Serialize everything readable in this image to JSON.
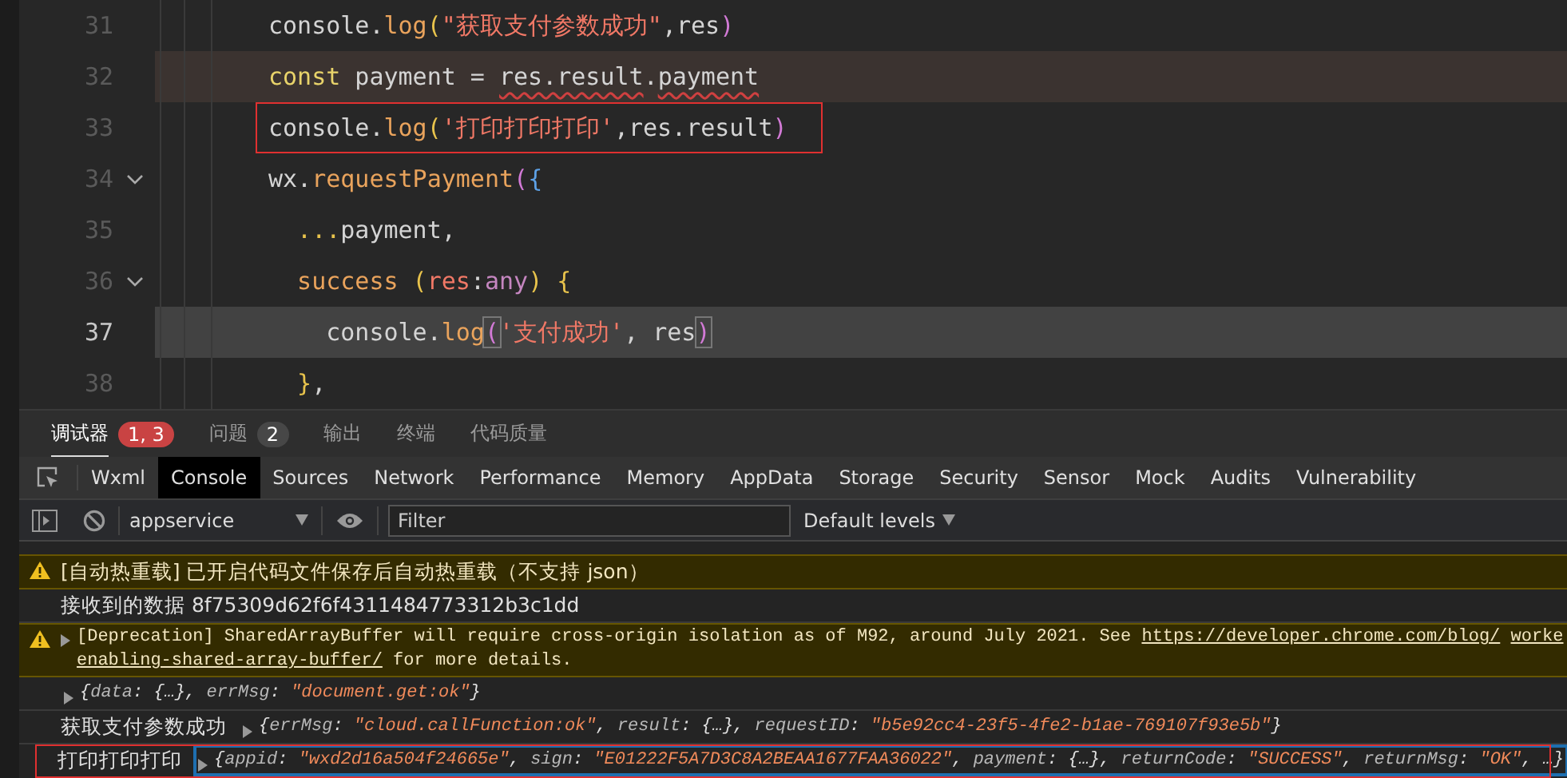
{
  "editor": {
    "lines": [
      {
        "number": "31",
        "fold": false,
        "current": false,
        "highlighted": false,
        "boxed": false,
        "tokens": [
          {
            "text": "console.",
            "kind": "plain"
          },
          {
            "text": "log",
            "kind": "method"
          },
          {
            "text": "(",
            "kind": "bracket"
          },
          {
            "text": "\"获取支付参数成功\"",
            "kind": "string"
          },
          {
            "text": ",res",
            "kind": "plain"
          },
          {
            "text": ")",
            "kind": "bracket2"
          }
        ]
      },
      {
        "number": "32",
        "fold": false,
        "current": false,
        "highlighted": true,
        "boxed": false,
        "tokens": [
          {
            "text": "const",
            "kind": "keyword"
          },
          {
            "text": " payment = ",
            "kind": "plain"
          },
          {
            "text": "res.result",
            "kind": "plain",
            "squiggle": true
          },
          {
            "text": ".",
            "kind": "plain"
          },
          {
            "text": "payment",
            "kind": "plain",
            "squiggle": true
          }
        ]
      },
      {
        "number": "33",
        "fold": false,
        "current": false,
        "highlighted": false,
        "boxed": true,
        "tokens": [
          {
            "text": "console.",
            "kind": "plain"
          },
          {
            "text": "log",
            "kind": "method"
          },
          {
            "text": "(",
            "kind": "bracket"
          },
          {
            "text": "'打印打印打印'",
            "kind": "string"
          },
          {
            "text": ",res.result",
            "kind": "plain"
          },
          {
            "text": ")",
            "kind": "bracket2"
          }
        ]
      },
      {
        "number": "34",
        "fold": true,
        "current": false,
        "highlighted": false,
        "boxed": false,
        "tokens": [
          {
            "text": "wx.",
            "kind": "plain"
          },
          {
            "text": "requestPayment",
            "kind": "method"
          },
          {
            "text": "(",
            "kind": "bracket2"
          },
          {
            "text": "{",
            "kind": "bracket3"
          }
        ]
      },
      {
        "number": "35",
        "fold": false,
        "current": false,
        "highlighted": false,
        "boxed": false,
        "tokens": [
          {
            "text": "  ...",
            "kind": "operator"
          },
          {
            "text": "payment,",
            "kind": "plain"
          }
        ]
      },
      {
        "number": "36",
        "fold": true,
        "current": false,
        "highlighted": false,
        "boxed": false,
        "tokens": [
          {
            "text": "  success",
            "kind": "method"
          },
          {
            "text": " (",
            "kind": "bracket"
          },
          {
            "text": "res",
            "kind": "param"
          },
          {
            "text": ":",
            "kind": "plain"
          },
          {
            "text": "any",
            "kind": "type"
          },
          {
            "text": ") {",
            "kind": "bracket"
          }
        ]
      },
      {
        "number": "37",
        "fold": false,
        "current": true,
        "highlighted": false,
        "boxed": false,
        "tokens": [
          {
            "text": "    console.",
            "kind": "plain"
          },
          {
            "text": "log",
            "kind": "method"
          },
          {
            "text": "(",
            "kind": "bracket2",
            "matched": true
          },
          {
            "text": "'支付成功'",
            "kind": "string"
          },
          {
            "text": ", res",
            "kind": "plain"
          },
          {
            "text": ")",
            "kind": "bracket2",
            "matched": true
          }
        ]
      },
      {
        "number": "38",
        "fold": false,
        "current": false,
        "highlighted": false,
        "boxed": false,
        "tokens": [
          {
            "text": "  }",
            "kind": "bracket"
          },
          {
            "text": ",",
            "kind": "plain"
          }
        ]
      }
    ]
  },
  "panel_tabs": [
    {
      "label": "调试器",
      "selected": true,
      "badge": "1, 3",
      "color": "#c94343"
    },
    {
      "label": "问题",
      "selected": false,
      "badge": "2",
      "color": "#474747"
    },
    {
      "label": "输出",
      "selected": false
    },
    {
      "label": "终端",
      "selected": false
    },
    {
      "label": "代码质量",
      "selected": false
    }
  ],
  "devtools_tabs": [
    {
      "label": "Wxml",
      "selected": false
    },
    {
      "label": "Console",
      "selected": true
    },
    {
      "label": "Sources",
      "selected": false
    },
    {
      "label": "Network",
      "selected": false
    },
    {
      "label": "Performance",
      "selected": false
    },
    {
      "label": "Memory",
      "selected": false
    },
    {
      "label": "AppData",
      "selected": false
    },
    {
      "label": "Storage",
      "selected": false
    },
    {
      "label": "Security",
      "selected": false
    },
    {
      "label": "Sensor",
      "selected": false
    },
    {
      "label": "Mock",
      "selected": false
    },
    {
      "label": "Audits",
      "selected": false
    },
    {
      "label": "Vulnerability",
      "selected": false
    }
  ],
  "toolbar": {
    "context": "appservice",
    "filter": {
      "placeholder": "Filter"
    },
    "levels": "Default levels"
  },
  "console": [
    {
      "kind": "warning",
      "expandable": false,
      "boxed": false,
      "lines": [
        [
          {
            "text": "[自动热重载] 已开启代码文件保存后自动热重载（不支持 json）",
            "kind": "text"
          }
        ]
      ]
    },
    {
      "kind": "log",
      "expandable": false,
      "boxed": false,
      "lines": [
        [
          {
            "text": "接收到的数据 8f75309d62f6f4311484773312b3c1dd",
            "kind": "text"
          }
        ]
      ]
    },
    {
      "kind": "warning",
      "expandable": true,
      "boxed": false,
      "lines": [
        [
          {
            "text": "[Deprecation] SharedArrayBuffer will require cross-origin isolation as of M92, around July 2021. See ",
            "kind": "text"
          },
          {
            "text": "https://developer.chrome.com/blog/",
            "kind": "link"
          },
          {
            "text": "worke",
            "kind": "link"
          }
        ],
        [
          {
            "text": "enabling-shared-array-buffer/",
            "kind": "link"
          },
          {
            "text": " for more details.",
            "kind": "text"
          }
        ]
      ]
    },
    {
      "kind": "log",
      "expandable": false,
      "boxed": false,
      "object": {
        "focused": false,
        "segments": [
          {
            "text": "{",
            "kind": "punct"
          },
          {
            "text": "data",
            "kind": "key"
          },
          {
            "text": ": {…}, ",
            "kind": "punct"
          },
          {
            "text": "errMsg",
            "kind": "key"
          },
          {
            "text": ": ",
            "kind": "punct"
          },
          {
            "text": "\"document.get:ok\"",
            "kind": "string"
          },
          {
            "text": "}",
            "kind": "punct"
          }
        ]
      }
    },
    {
      "kind": "log",
      "expandable": false,
      "boxed": false,
      "label": "获取支付参数成功",
      "object": {
        "focused": false,
        "segments": [
          {
            "text": "{",
            "kind": "punct"
          },
          {
            "text": "errMsg",
            "kind": "key"
          },
          {
            "text": ": ",
            "kind": "punct"
          },
          {
            "text": "\"cloud.callFunction:ok\"",
            "kind": "string"
          },
          {
            "text": ", ",
            "kind": "punct"
          },
          {
            "text": "result",
            "kind": "key"
          },
          {
            "text": ": {…}, ",
            "kind": "punct"
          },
          {
            "text": "requestID",
            "kind": "key"
          },
          {
            "text": ": ",
            "kind": "punct"
          },
          {
            "text": "\"b5e92cc4-23f5-4fe2-b1ae-769107f93e5b\"",
            "kind": "string"
          },
          {
            "text": "}",
            "kind": "punct"
          }
        ]
      }
    },
    {
      "kind": "log",
      "expandable": false,
      "boxed": true,
      "label": "打印打印打印",
      "object": {
        "focused": true,
        "segments": [
          {
            "text": "{",
            "kind": "punct"
          },
          {
            "text": "appid",
            "kind": "key"
          },
          {
            "text": ": ",
            "kind": "punct"
          },
          {
            "text": "\"wxd2d16a504f24665e\"",
            "kind": "string"
          },
          {
            "text": ", ",
            "kind": "punct"
          },
          {
            "text": "sign",
            "kind": "key"
          },
          {
            "text": ": ",
            "kind": "punct"
          },
          {
            "text": "\"E01222F5A7D3C8A2BEAA1677FAA36022\"",
            "kind": "string"
          },
          {
            "text": ", ",
            "kind": "punct"
          },
          {
            "text": "payment",
            "kind": "key"
          },
          {
            "text": ": {…}, ",
            "kind": "punct"
          },
          {
            "text": "returnCode",
            "kind": "key"
          },
          {
            "text": ": ",
            "kind": "punct"
          },
          {
            "text": "\"SUCCESS\"",
            "kind": "string"
          },
          {
            "text": ", ",
            "kind": "punct"
          },
          {
            "text": "returnMsg",
            "kind": "key"
          },
          {
            "text": ": ",
            "kind": "punct"
          },
          {
            "text": "\"OK\"",
            "kind": "string"
          },
          {
            "text": ", …}",
            "kind": "punct"
          }
        ]
      }
    }
  ]
}
